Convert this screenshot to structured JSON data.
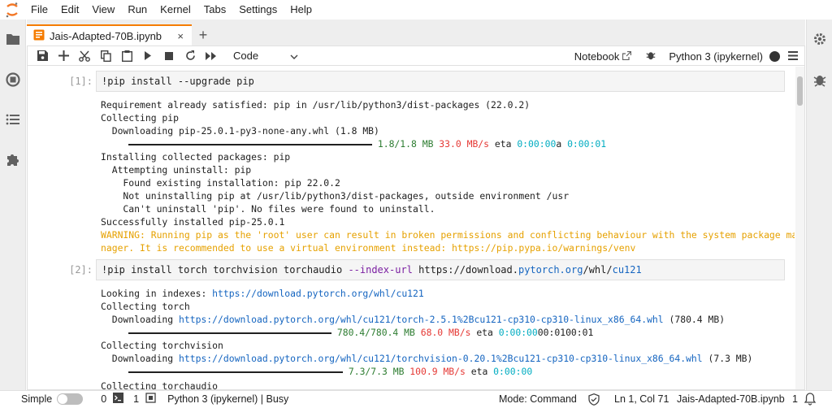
{
  "menu": [
    "File",
    "Edit",
    "View",
    "Run",
    "Kernel",
    "Tabs",
    "Settings",
    "Help"
  ],
  "tab": {
    "title": "Jais-Adapted-70B.ipynb",
    "close": "×",
    "add": "+"
  },
  "toolbar": {
    "cell_type": "Code",
    "notebook_label": "Notebook",
    "kernel_name": "Python 3 (ipykernel)"
  },
  "cells": [
    {
      "prompt": "[1]:",
      "command": "pip install --upgrade pip",
      "output": {
        "l1": "Requirement already satisfied: pip in /usr/lib/python3/dist-packages (22.0.2)",
        "l2": "Collecting pip",
        "l3": "  Downloading pip-25.0.1-py3-none-any.whl (1.8 MB)",
        "p1_size": "1.8/1.8 MB",
        "p1_speed": "33.0 MB/s",
        "p1_eta": "eta",
        "p1_time": "0:00:00",
        "p1_a": "a",
        "p1_time2": "0:00:01",
        "l5": "Installing collected packages: pip",
        "l6": "  Attempting uninstall: pip",
        "l7": "    Found existing installation: pip 22.0.2",
        "l8": "    Not uninstalling pip at /usr/lib/python3/dist-packages, outside environment /usr",
        "l9": "    Can't uninstall 'pip'. No files were found to uninstall.",
        "l10": "Successfully installed pip-25.0.1",
        "w1": "WARNING: Running pip as the 'root' user can result in broken permissions and conflicting behaviour with the system package ma",
        "w2": "nager. It is recommended to use a virtual environment instead: https://pip.pypa.io/warnings/venv"
      }
    },
    {
      "prompt": "[2]:",
      "command_pre": "!pip install torch torchvision torchaudio ",
      "command_flag": "--index-url",
      "command_url1": "https://download.",
      "command_url2": "pytorch.org",
      "command_url3": "/whl/",
      "command_url4": "cu121",
      "output": {
        "l1_pre": "Looking in indexes: ",
        "l1_url": "https://download.pytorch.org/whl/cu121",
        "l2": "Collecting torch",
        "l3_pre": "  Downloading ",
        "l3_url": "https://download.pytorch.org/whl/cu121/torch-2.5.1%2Bcu121-cp310-cp310-linux_x86_64.whl",
        "l3_post": " (780.4 MB)",
        "p1_size": "780.4/780.4 MB",
        "p1_speed": "68.0 MB/s",
        "p1_eta": "eta",
        "p1_time": "0:00:00",
        "p1_tail": "00:0100:01",
        "l5": "Collecting torchvision",
        "l6_pre": "  Downloading ",
        "l6_url": "https://download.pytorch.org/whl/cu121/torchvision-0.20.1%2Bcu121-cp310-cp310-linux_x86_64.whl",
        "l6_post": " (7.3 MB)",
        "p2_size": "7.3/7.3 MB",
        "p2_speed": "100.9 MB/s",
        "p2_eta": "eta",
        "p2_time": "0:00:00",
        "l8": "Collecting torchaudio"
      }
    }
  ],
  "statusbar": {
    "mode_label": "Simple",
    "terminals": "0",
    "kernels": "1",
    "kernel_status": "Python 3 (ipykernel) | Busy",
    "mode": "Mode: Command",
    "position": "Ln 1, Col 71",
    "filename": "Jais-Adapted-70B.ipynb",
    "notifications": "1"
  },
  "colors": {
    "accent": "#f57c00",
    "url": "#1565c0",
    "warning": "#e6a100",
    "progress": "#2e7d32"
  }
}
